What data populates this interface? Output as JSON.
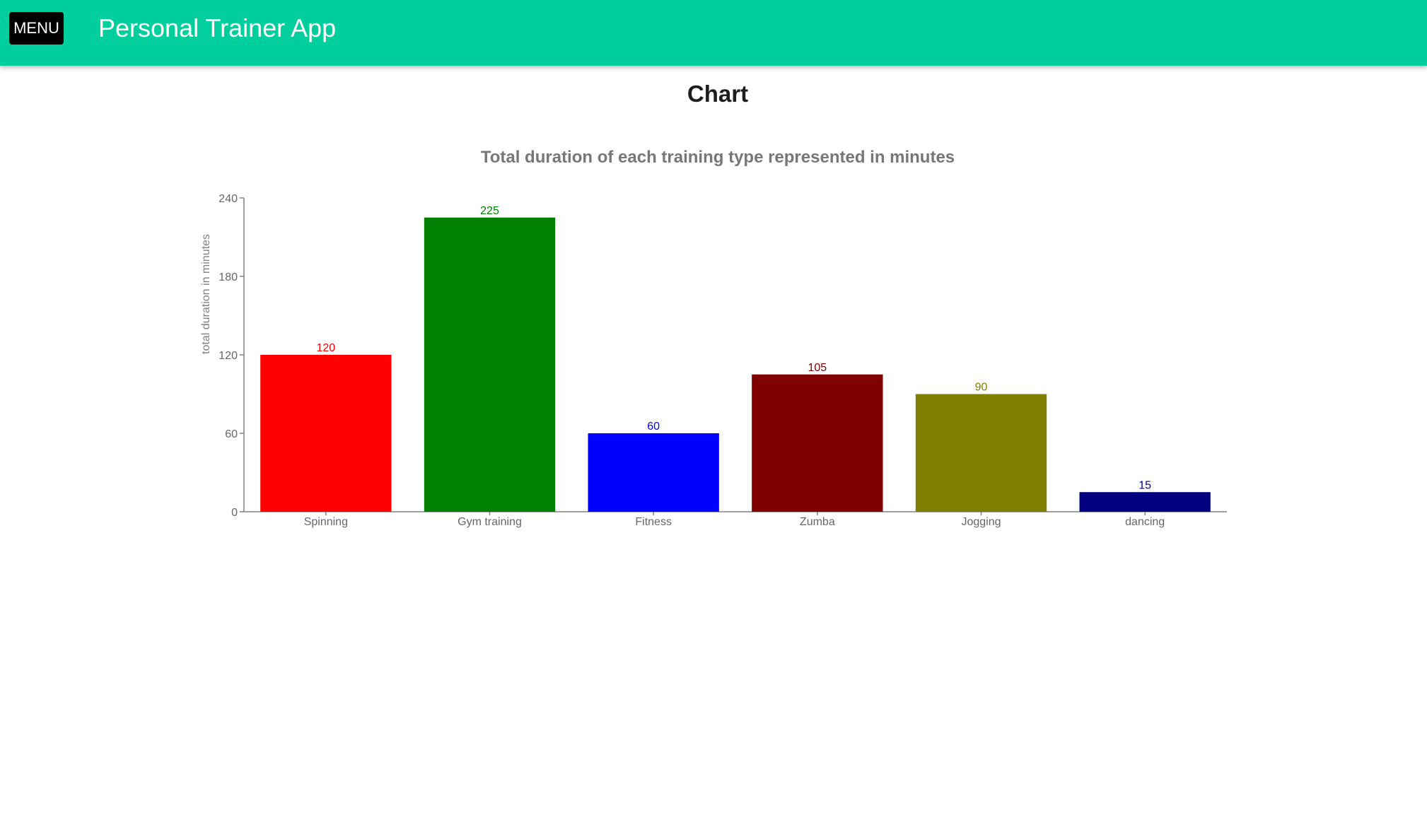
{
  "header": {
    "menu_label": "MENU",
    "app_title": "Personal Trainer App",
    "background_color": "#00ce9c"
  },
  "page": {
    "heading": "Chart"
  },
  "chart_data": {
    "type": "bar",
    "title": "Total duration of each training type represented in minutes",
    "xlabel": "",
    "ylabel": "total duration in minutes",
    "categories": [
      "Spinning",
      "Gym training",
      "Fitness",
      "Zumba",
      "Jogging",
      "dancing"
    ],
    "values": [
      120,
      225,
      60,
      105,
      90,
      15
    ],
    "colors": [
      "#ff0000",
      "#008000",
      "#0000ff",
      "#800000",
      "#808000",
      "#000080"
    ],
    "ylim": [
      0,
      240
    ],
    "yticks": [
      0,
      60,
      120,
      180,
      240
    ],
    "grid": false,
    "legend": "none",
    "data_labels": true
  }
}
